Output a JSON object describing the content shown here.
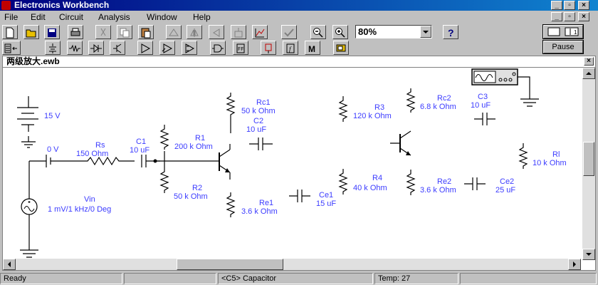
{
  "window": {
    "title": "Electronics Workbench"
  },
  "menu": [
    "File",
    "Edit",
    "Circuit",
    "Analysis",
    "Window",
    "Help"
  ],
  "toolbar": {
    "zoom": "80%",
    "pause": "Pause"
  },
  "document": {
    "title": "两级放大.ewb"
  },
  "circuit": {
    "battery": "15 V",
    "vin": {
      "name": "Vin",
      "value": "1 mV/1 kHz/0 Deg"
    },
    "zero_v": "0 V",
    "rs": {
      "name": "Rs",
      "value": "150  Ohm"
    },
    "c1": {
      "name": "C1",
      "value": "10 uF"
    },
    "r1": {
      "name": "R1",
      "value": "200 k Ohm"
    },
    "r2": {
      "name": "R2",
      "value": "50 k Ohm"
    },
    "rc1": {
      "name": "Rc1",
      "value": "50 k Ohm"
    },
    "c2": {
      "name": "C2",
      "value": "10 uF"
    },
    "re1": {
      "name": "Re1",
      "value": "3.6 k Ohm"
    },
    "ce1": {
      "name": "Ce1",
      "value": "15 uF"
    },
    "r3": {
      "name": "R3",
      "value": "120 k Ohm"
    },
    "r4": {
      "name": "R4",
      "value": "40 k Ohm"
    },
    "rc2": {
      "name": "Rc2",
      "value": "6.8 k Ohm"
    },
    "c3": {
      "name": "C3",
      "value": "10 uF"
    },
    "re2": {
      "name": "Re2",
      "value": "3.6 k Ohm"
    },
    "ce2": {
      "name": "Ce2",
      "value": "25 uF"
    },
    "rl": {
      "name": "Rl",
      "value": "10 k Ohm"
    }
  },
  "status": {
    "ready": "Ready",
    "selection": "<C5> Capacitor",
    "temp": "Temp:  27"
  }
}
